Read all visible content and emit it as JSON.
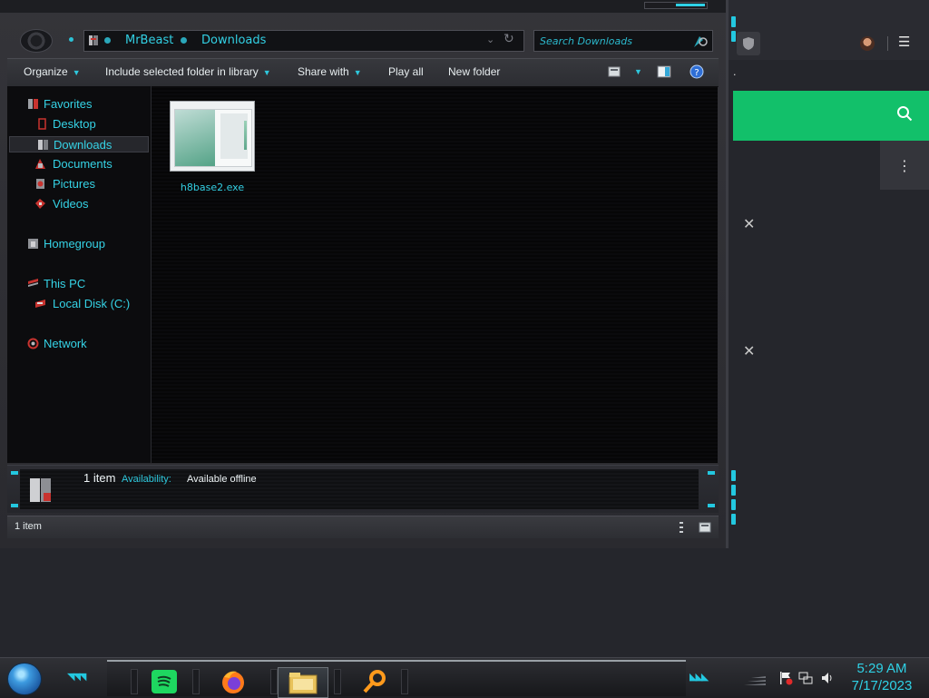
{
  "explorer": {
    "address": {
      "crumbs": [
        "MrBeast",
        "Downloads"
      ],
      "search_placeholder": "Search Downloads"
    },
    "toolbar": {
      "organize": "Organize",
      "include_in_library": "Include selected folder in library",
      "share_with": "Share with",
      "play_all": "Play all",
      "new_folder": "New folder"
    },
    "nav": {
      "favorites": "Favorites",
      "desktop": "Desktop",
      "downloads": "Downloads",
      "documents": "Documents",
      "pictures": "Pictures",
      "videos": "Videos",
      "homegroup": "Homegroup",
      "this_pc": "This PC",
      "local_disk": "Local Disk (C:)",
      "network": "Network"
    },
    "files": [
      {
        "name": "h8base2.exe"
      }
    ],
    "details": {
      "count": "1 item",
      "availability_label": "Availability:",
      "availability_value": "Available offline"
    },
    "status": {
      "text": "1 item"
    }
  },
  "browser": {
    "menu_glyph": "☰",
    "accent_color": "#12c06a"
  },
  "taskbar": {
    "time": "5:29 AM",
    "date": "7/17/2023",
    "apps": [
      "spotify-icon",
      "firefox-icon",
      "file-explorer-icon",
      "search-app-icon"
    ]
  },
  "theme": {
    "accent": "#2ed1e6",
    "window_bg": "#0a0a0c"
  }
}
